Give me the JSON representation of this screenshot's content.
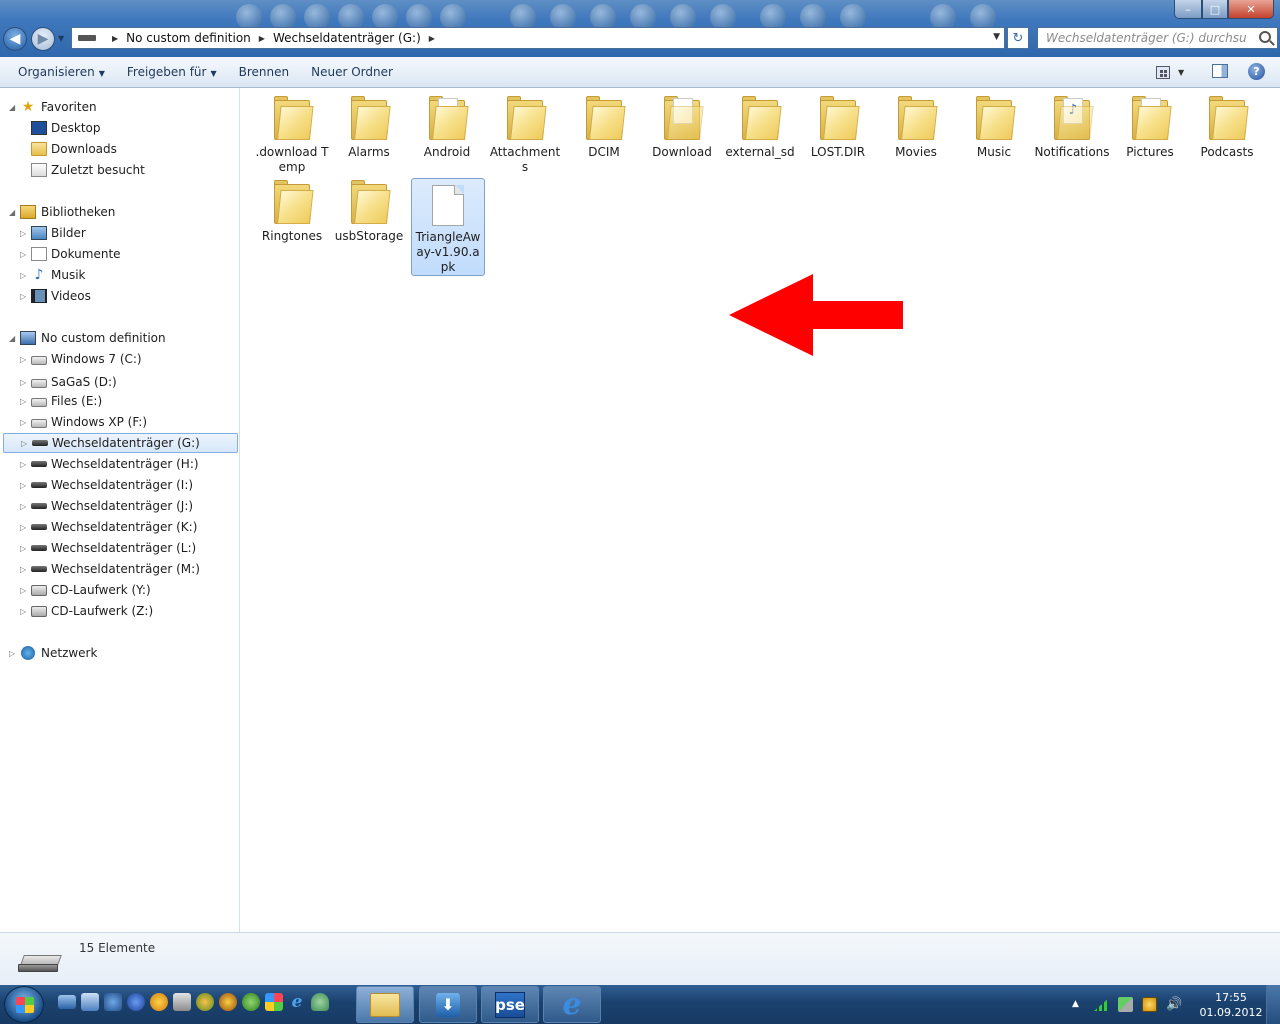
{
  "window": {
    "minimize": "–",
    "maximize": "□",
    "close": "✕"
  },
  "address": {
    "crumbs": [
      "No custom definition",
      "Wechseldatenträger (G:)"
    ]
  },
  "search": {
    "placeholder": "Wechseldatenträger (G:) durchsuchen"
  },
  "toolbar": {
    "organize": "Organisieren",
    "share": "Freigeben für",
    "burn": "Brennen",
    "new_folder": "Neuer Ordner",
    "help": "?"
  },
  "nav": {
    "favorites": {
      "label": "Favoriten",
      "items": [
        "Desktop",
        "Downloads",
        "Zuletzt besucht"
      ]
    },
    "libraries": {
      "label": "Bibliotheken",
      "items": [
        "Bilder",
        "Dokumente",
        "Musik",
        "Videos"
      ]
    },
    "computer": {
      "label": "No custom definition",
      "items": [
        {
          "label": "Windows 7 (C:)",
          "icon": "windows-drive-icon"
        },
        {
          "label": "SaGaS (D:)",
          "icon": "hard-drive-icon"
        },
        {
          "label": "Files (E:)",
          "icon": "hard-drive-icon"
        },
        {
          "label": "Windows XP (F:)",
          "icon": "hard-drive-icon"
        },
        {
          "label": "Wechseldatenträger (G:)",
          "icon": "removable-drive-icon",
          "selected": true
        },
        {
          "label": "Wechseldatenträger (H:)",
          "icon": "removable-drive-icon"
        },
        {
          "label": "Wechseldatenträger (I:)",
          "icon": "removable-drive-icon"
        },
        {
          "label": "Wechseldatenträger (J:)",
          "icon": "removable-drive-icon"
        },
        {
          "label": "Wechseldatenträger (K:)",
          "icon": "removable-drive-icon"
        },
        {
          "label": "Wechseldatenträger (L:)",
          "icon": "removable-drive-icon"
        },
        {
          "label": "Wechseldatenträger (M:)",
          "icon": "removable-drive-icon"
        },
        {
          "label": "CD-Laufwerk (Y:)",
          "icon": "cd-drive-icon"
        },
        {
          "label": "CD-Laufwerk (Z:)",
          "icon": "cd-drive-icon"
        }
      ]
    },
    "network": {
      "label": "Netzwerk"
    }
  },
  "files": [
    {
      "name": ".download Temp",
      "type": "folder"
    },
    {
      "name": "Alarms",
      "type": "folder"
    },
    {
      "name": "Android",
      "type": "folder"
    },
    {
      "name": "Attachments",
      "type": "folder"
    },
    {
      "name": "DCIM",
      "type": "folder"
    },
    {
      "name": "Download",
      "type": "folder-doc"
    },
    {
      "name": "external_sd",
      "type": "folder"
    },
    {
      "name": "LOST.DIR",
      "type": "folder"
    },
    {
      "name": "Movies",
      "type": "folder"
    },
    {
      "name": "Music",
      "type": "folder"
    },
    {
      "name": "Notifications",
      "type": "folder-music"
    },
    {
      "name": "Pictures",
      "type": "folder"
    },
    {
      "name": "Podcasts",
      "type": "folder"
    },
    {
      "name": "Ringtones",
      "type": "folder"
    },
    {
      "name": "usbStorage",
      "type": "folder"
    },
    {
      "name": "TriangleAway-v1.90.apk",
      "type": "file",
      "selected": true
    }
  ],
  "annotation": {
    "arrow_color": "#ff0000"
  },
  "details": {
    "count": "15 Elemente"
  },
  "taskbar": {
    "pse_label": "pse",
    "ie_label": "e",
    "clock_time": "17:55",
    "clock_date": "01.09.2012"
  },
  "colors": {
    "selection": "#cce4fc",
    "titlebar": "#3f78bd",
    "taskbar": "#1b416e"
  }
}
